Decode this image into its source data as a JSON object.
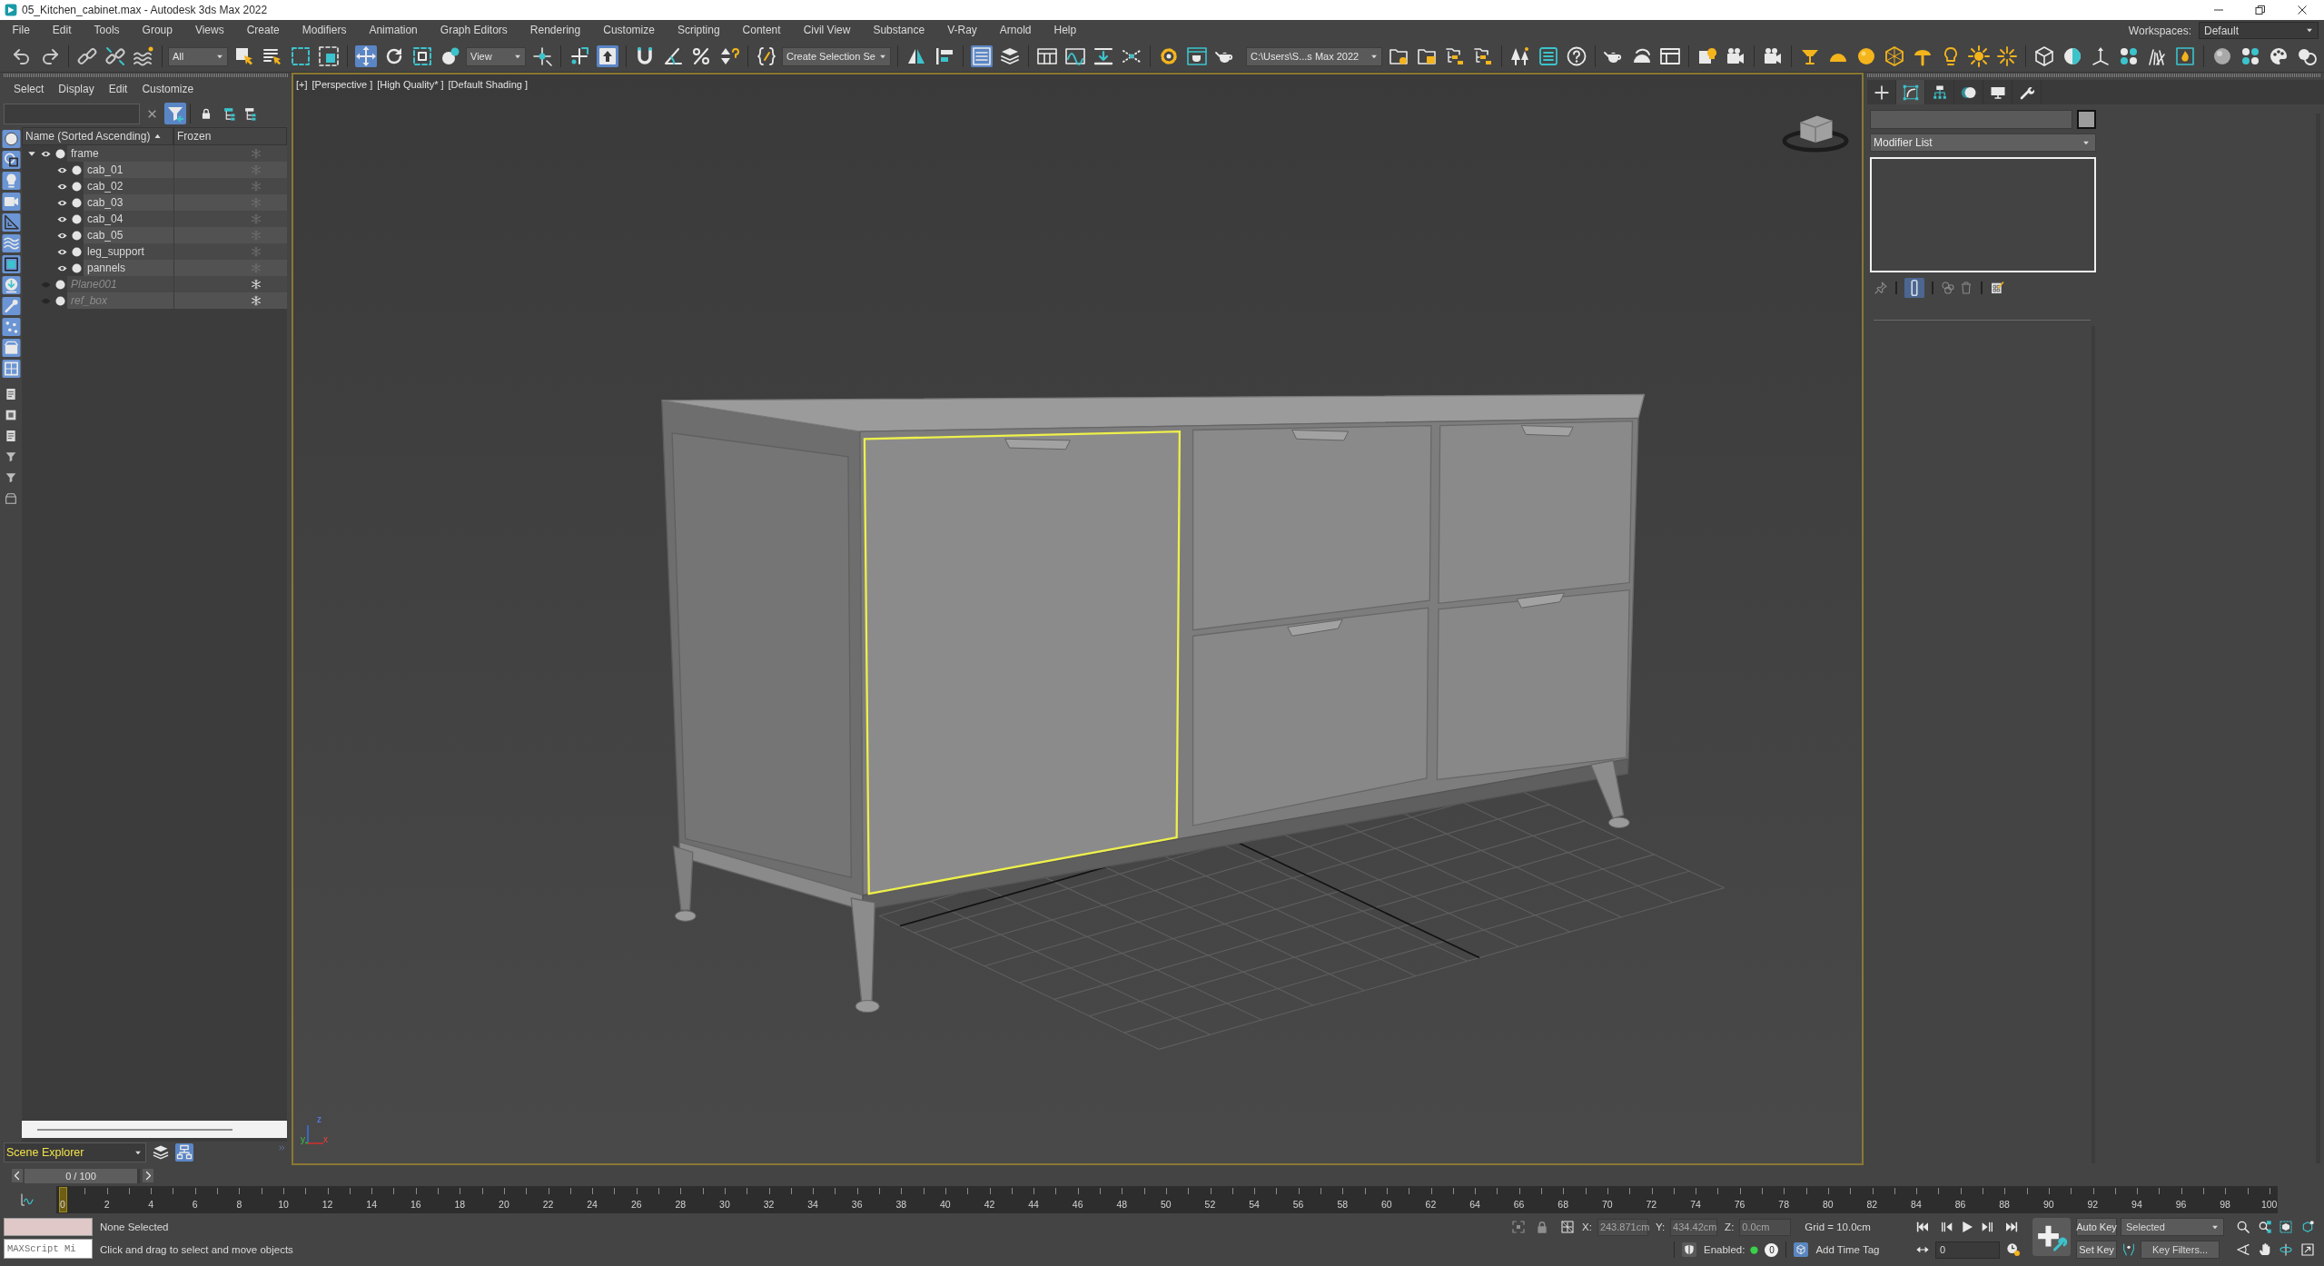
{
  "window": {
    "title": "05_Kitchen_cabinet.max - Autodesk 3ds Max 2022"
  },
  "menu_bar": {
    "items": [
      "File",
      "Edit",
      "Tools",
      "Group",
      "Views",
      "Create",
      "Modifiers",
      "Animation",
      "Graph Editors",
      "Rendering",
      "Customize",
      "Scripting",
      "Content",
      "Civil View",
      "Substance",
      "V-Ray",
      "Arnold",
      "Help"
    ],
    "workspaces_label": "Workspaces:",
    "workspace": "Default"
  },
  "main_toolbar": {
    "selection_filter": "All",
    "transform_tools": [
      {
        "selected": false
      },
      {
        "selected": true
      },
      {
        "selected": false
      },
      {
        "selected": false
      },
      {
        "selected": false
      }
    ],
    "reference_coordinate_system": "View",
    "keyboard_override": {
      "on": true
    },
    "named_selection_set": "Create Selection Se",
    "scene_explorer_toggle": {
      "on": true
    },
    "project_folder": "C:\\Users\\S...s Max 2022"
  },
  "scene_explorer": {
    "menu": [
      "Select",
      "Display",
      "Edit",
      "Customize"
    ],
    "filter": {
      "on": true
    },
    "display_filters": [
      {
        "on": true
      },
      {
        "on": true
      },
      {
        "on": true
      },
      {
        "on": true
      },
      {
        "on": true
      },
      {
        "on": true
      },
      {
        "on": true
      },
      {
        "on": true
      },
      {
        "on": true
      },
      {
        "on": true
      },
      {
        "on": true
      },
      {
        "on": true
      }
    ],
    "columns": [
      {
        "label": "Name (Sorted Ascending)",
        "sorted": true
      },
      {
        "label": "Frozen",
        "sorted": false
      }
    ],
    "tree": [
      {
        "name": "frame",
        "expanded": true,
        "visible": true,
        "frozen": false,
        "children": [
          {
            "name": "cab_01",
            "visible": true,
            "frozen": false
          },
          {
            "name": "cab_02",
            "visible": true,
            "frozen": false
          },
          {
            "name": "cab_03",
            "visible": true,
            "frozen": false
          },
          {
            "name": "cab_04",
            "visible": true,
            "frozen": false
          },
          {
            "name": "cab_05",
            "visible": true,
            "frozen": false
          },
          {
            "name": "leg_support",
            "visible": true,
            "frozen": false
          },
          {
            "name": "pannels",
            "visible": true,
            "frozen": false
          }
        ]
      },
      {
        "name": "Plane001",
        "visible": false,
        "frozen": true
      },
      {
        "name": "ref_box",
        "visible": false,
        "frozen": true
      }
    ],
    "explorer_selector": "Scene Explorer",
    "view_modes": [
      {
        "selected": false
      },
      {
        "selected": true
      }
    ]
  },
  "viewport": {
    "labels": [
      "[+]",
      "[Perspective ]",
      "[High Quality* ]",
      "[Default Shading ]"
    ],
    "axis_labels": [
      "z",
      "y",
      "x"
    ]
  },
  "command_panel": {
    "tabs": [
      {
        "selected": false
      },
      {
        "selected": true
      },
      {
        "selected": false
      },
      {
        "selected": false
      },
      {
        "selected": false
      },
      {
        "selected": false
      }
    ],
    "modifier_list": "Modifier List",
    "show_end_result": {
      "on": true
    }
  },
  "time_slider": {
    "label": "0 / 100",
    "level": 0
  },
  "track_bar": {
    "level": 0,
    "labels": [
      "0",
      "2",
      "4",
      "6",
      "8",
      "10",
      "12",
      "14",
      "16",
      "18",
      "20",
      "22",
      "24",
      "26",
      "28",
      "30",
      "32",
      "34",
      "36",
      "38",
      "40",
      "42",
      "44",
      "46",
      "48",
      "50",
      "52",
      "54",
      "56",
      "58",
      "60",
      "62",
      "64",
      "66",
      "68",
      "70",
      "72",
      "74",
      "76",
      "78",
      "80",
      "82",
      "84",
      "86",
      "88",
      "90",
      "92",
      "94",
      "96",
      "98",
      "100"
    ]
  },
  "status_bar": {
    "maxscript_listener": "MAXScript Mi",
    "selection_info": "None Selected",
    "prompt": "Click and drag to select and move objects",
    "coordinates": [
      {
        "axis": "X:",
        "value": "243.871cm",
        "disabled": true
      },
      {
        "axis": "Y:",
        "value": "434.42cm",
        "disabled": true
      },
      {
        "axis": "Z:",
        "value": "0.0cm",
        "disabled": true
      }
    ],
    "grid": "Grid = 10.0cm",
    "adaptive_degradation": {
      "label": "Enabled:",
      "on": true,
      "value": "0"
    },
    "time_tag": "Add Time Tag"
  },
  "animation_controls": {
    "auto_key": "Auto Key",
    "key_set": "Selected",
    "frame": "0",
    "set_key": "Set Key",
    "key_filters": "Key Filters..."
  }
}
